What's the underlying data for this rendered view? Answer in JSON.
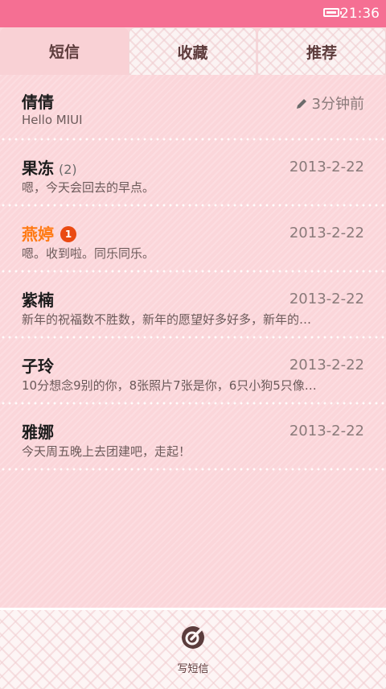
{
  "status_bar": {
    "time": "21:36",
    "battery_icon": "battery-icon"
  },
  "tabs": [
    {
      "label": "短信",
      "active": true
    },
    {
      "label": "收藏",
      "active": false
    },
    {
      "label": "推荐",
      "active": false
    }
  ],
  "conversations": [
    {
      "name": "倩倩",
      "count": "",
      "unread_badge": "",
      "time": "3分钟前",
      "preview": "Hello MIUI",
      "draft_icon": "pencil-icon"
    },
    {
      "name": "果冻",
      "count": "(2)",
      "unread_badge": "",
      "time": "2013-2-22",
      "preview": "嗯，今天会回去的早点。"
    },
    {
      "name": "燕婷",
      "count": "",
      "unread_badge": "1",
      "time": "2013-2-22",
      "preview": "嗯。收到啦。同乐同乐。"
    },
    {
      "name": "紫楠",
      "count": "",
      "unread_badge": "",
      "time": "2013-2-22",
      "preview": "新年的祝福数不胜数，新年的愿望好多好多，新年的…"
    },
    {
      "name": "子玲",
      "count": "",
      "unread_badge": "",
      "time": "2013-2-22",
      "preview": "10分想念9别的你，8张照片7张是你，6只小狗5只像…"
    },
    {
      "name": "雅娜",
      "count": "",
      "unread_badge": "",
      "time": "2013-2-22",
      "preview": "今天周五晚上去团建吧，走起！"
    }
  ],
  "bottom_bar": {
    "compose_label": "写短信",
    "compose_icon": "compose-icon"
  },
  "colors": {
    "status_bar": "#f56f93",
    "background": "#fbd6da",
    "unread_name": "#ff7a14",
    "badge": "#ea4a12"
  }
}
